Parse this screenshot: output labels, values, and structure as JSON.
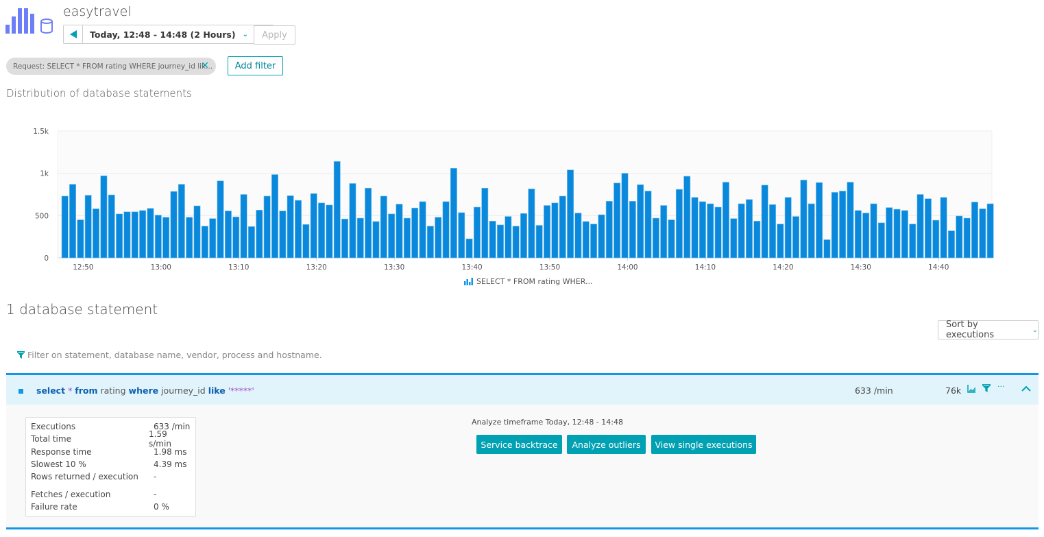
{
  "header": {
    "app_title": "easytravel",
    "timeframe_label": "Today, 12:48 - 14:48 (2 Hours)",
    "apply_label": "Apply",
    "icons": {
      "prev": "triangle-left-icon",
      "next": "triangle-right-icon",
      "dropdown": "chevron-down-icon",
      "logo": "database-bars-icon"
    }
  },
  "filters": {
    "chip_label": "Request: SELECT * FROM rating WHERE journey_id lik...",
    "add_filter_label": "Add filter"
  },
  "distribution": {
    "title": "Distribution of database statements",
    "legend_label": "SELECT * FROM rating WHER..."
  },
  "chart_data": {
    "type": "bar",
    "title": "Distribution of database statements",
    "xlabel": "",
    "ylabel": "",
    "ylim": [
      0,
      1500
    ],
    "y_ticks": [
      "0",
      "500",
      "1k",
      "1.5k"
    ],
    "y_tick_values": [
      0,
      500,
      1000,
      1500
    ],
    "x_start": "12:48",
    "x_interval_minutes": 1,
    "x_tick_labels": [
      "12:50",
      "13:00",
      "13:10",
      "13:20",
      "13:30",
      "13:40",
      "13:50",
      "14:00",
      "14:10",
      "14:20",
      "14:30",
      "14:40"
    ],
    "x_tick_indices": [
      2,
      12,
      22,
      32,
      42,
      52,
      62,
      72,
      82,
      92,
      102,
      112
    ],
    "grid": true,
    "legend_position": "bottom-center",
    "series": [
      {
        "name": "SELECT * FROM rating WHER...",
        "color": "#0a88db",
        "values": [
          730,
          870,
          450,
          740,
          580,
          970,
          745,
          520,
          545,
          545,
          560,
          585,
          505,
          480,
          785,
          870,
          480,
          615,
          375,
          465,
          910,
          555,
          485,
          750,
          370,
          565,
          730,
          985,
          555,
          735,
          680,
          395,
          760,
          650,
          625,
          1140,
          460,
          880,
          470,
          825,
          430,
          730,
          520,
          635,
          470,
          590,
          665,
          375,
          480,
          665,
          1060,
          535,
          225,
          600,
          825,
          435,
          390,
          490,
          375,
          525,
          815,
          385,
          620,
          650,
          730,
          1040,
          530,
          430,
          400,
          510,
          670,
          885,
          1000,
          670,
          865,
          790,
          470,
          620,
          450,
          810,
          965,
          715,
          665,
          640,
          600,
          895,
          465,
          640,
          690,
          435,
          860,
          630,
          400,
          715,
          490,
          920,
          640,
          890,
          215,
          775,
          790,
          895,
          560,
          530,
          640,
          415,
          595,
          575,
          560,
          400,
          750,
          700,
          445,
          715,
          320,
          495,
          470,
          660,
          580,
          640
        ]
      }
    ]
  },
  "statements": {
    "count_title": "1 database statement",
    "sort_label": "Sort by executions",
    "filter_placeholder": "Filter on statement, database name, vendor, process and hostname.",
    "rows": [
      {
        "statement_parts": {
          "kw_select": "select",
          "star": "*",
          "kw_from": "from",
          "table": "rating",
          "kw_where": "where",
          "column": "journey_id",
          "kw_like": "like",
          "literal": "'*****'"
        },
        "rate": "633 /min",
        "count": "76k",
        "details": {
          "stats": [
            {
              "label": "Executions",
              "value": "633 /min"
            },
            {
              "label": "Total time",
              "value": "1.59 s/min"
            },
            {
              "label": "Response time",
              "value": "1.98 ms"
            },
            {
              "label": "Slowest 10 %",
              "value": "4.39 ms"
            },
            {
              "label": "Rows returned / execution",
              "value": "-"
            },
            {
              "label": "Fetches / execution",
              "value": "-"
            },
            {
              "label": "Failure rate",
              "value": "0 %"
            }
          ],
          "analyze_label": "Analyze timeframe Today, 12:48 - 14:48",
          "buttons": [
            "Service backtrace",
            "Analyze outliers",
            "View single executions"
          ]
        }
      }
    ]
  },
  "colors": {
    "accent": "#00a1b2",
    "bar": "#0a88db",
    "row_highlight": "#e2f4fb",
    "row_border": "#1496e6"
  }
}
